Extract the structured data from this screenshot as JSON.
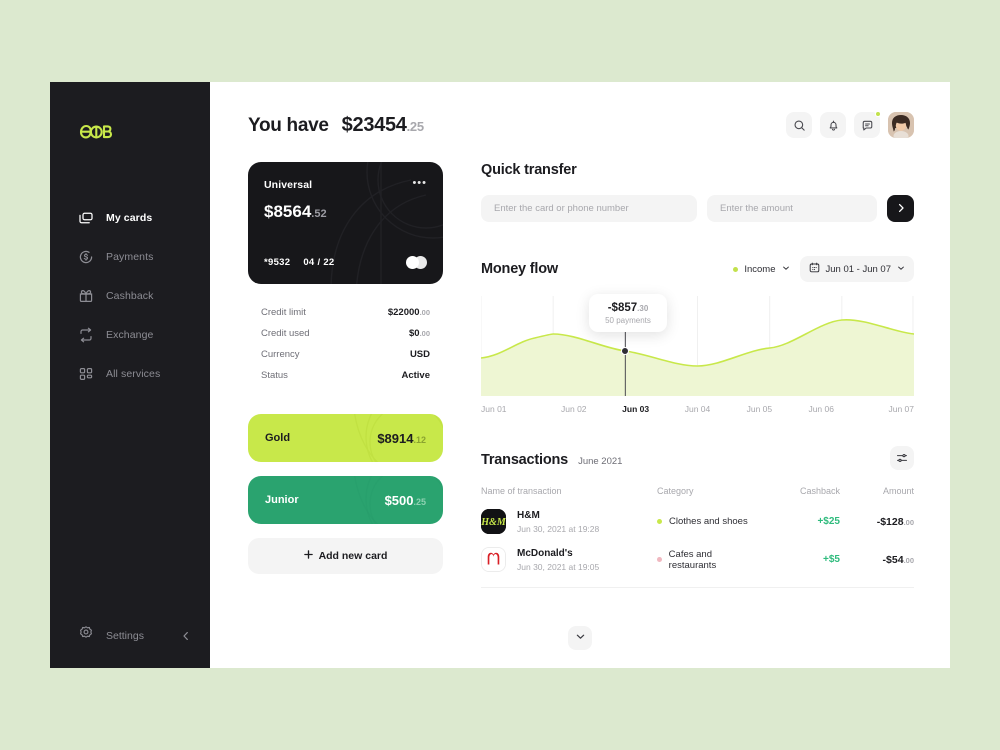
{
  "sidebar": {
    "logo_name": "brand-logo",
    "items": [
      {
        "label": "My cards",
        "icon": "cards-icon",
        "active": true
      },
      {
        "label": "Payments",
        "icon": "dollar-circle-icon",
        "active": false
      },
      {
        "label": "Cashback",
        "icon": "gift-icon",
        "active": false
      },
      {
        "label": "Exchange",
        "icon": "exchange-icon",
        "active": false
      },
      {
        "label": "All services",
        "icon": "grid-icon",
        "active": false
      }
    ],
    "settings_label": "Settings",
    "settings_icon": "gear-icon",
    "collapse_icon": "chevron-left-icon"
  },
  "header": {
    "greeting": "You have",
    "balance": "$23454",
    "balance_cents": ".25",
    "icons": [
      "search-icon",
      "bell-icon",
      "chat-icon"
    ],
    "chat_has_badge": true,
    "avatar": "user-avatar"
  },
  "main_card": {
    "name": "Universal",
    "menu_icon": "more-dots-icon",
    "balance": "$8564",
    "balance_cents": ".52",
    "number": "*9532",
    "expiry": "04 / 22",
    "brand": "mastercard-logo",
    "details": [
      {
        "label": "Credit limit",
        "value": "$22000",
        "cents": ".00"
      },
      {
        "label": "Credit used",
        "value": "$0",
        "cents": ".00"
      },
      {
        "label": "Currency",
        "value": "USD",
        "cents": ""
      },
      {
        "label": "Status",
        "value": "Active",
        "cents": ""
      }
    ]
  },
  "mini_cards": [
    {
      "name": "Gold",
      "balance": "$8914",
      "cents": ".12",
      "color": "#c8e84a"
    },
    {
      "name": "Junior",
      "balance": "$500",
      "cents": ".25",
      "color": "#2aa36f"
    }
  ],
  "add_card": {
    "label": "Add new card",
    "icon": "plus-icon"
  },
  "quick_transfer": {
    "title": "Quick transfer",
    "card_placeholder": "Enter the card or phone number",
    "card_value": "",
    "amount_placeholder": "Enter the amount",
    "amount_value": "",
    "submit_icon": "chevron-right-icon"
  },
  "money_flow": {
    "title": "Money flow",
    "filter_label": "Income",
    "filter_chevron": "chevron-down-icon",
    "date_range": "Jun 01 - Jun 07",
    "calendar_icon": "calendar-icon",
    "tooltip": {
      "amount": "-$857",
      "cents": ".30",
      "sub": "50 payments"
    }
  },
  "chart_data": {
    "type": "area",
    "title": "Money flow",
    "categories": [
      "Jun 01",
      "Jun 02",
      "Jun 03",
      "Jun 04",
      "Jun 05",
      "Jun 06",
      "Jun 07"
    ],
    "x": [
      0,
      1,
      2,
      3,
      4,
      5,
      6
    ],
    "values": [
      38,
      58,
      45,
      30,
      48,
      76,
      62
    ],
    "ylim": [
      0,
      100
    ],
    "xlabel": "",
    "ylabel": "",
    "grid": true,
    "legend": [
      "Income"
    ],
    "line_color": "#c8e84a",
    "fill_color": "#eef6d2",
    "active_index": 2,
    "active_label": "Jun 03",
    "annotations": [
      {
        "x": 2,
        "label": "-$857.30",
        "sub": "50 payments"
      }
    ]
  },
  "transactions": {
    "title": "Transactions",
    "period": "June 2021",
    "filter_icon": "settings-sliders-icon",
    "columns": [
      "Name of transaction",
      "Category",
      "Cashback",
      "Amount"
    ],
    "rows": [
      {
        "logo": "hm-logo",
        "name": "H&M",
        "date": "Jun 30, 2021 at 19:28",
        "category": "Clothes and shoes",
        "category_color": "#c8e84a",
        "cashback": "+$25",
        "amount": "-$128",
        "amount_cents": ".00"
      },
      {
        "logo": "mcdonalds-logo",
        "name": "McDonald's",
        "date": "Jun 30, 2021 at 19:05",
        "category": "Cafes and restaurants",
        "category_color": "#f0b8c0",
        "cashback": "+$5",
        "amount": "-$54",
        "amount_cents": ".00"
      }
    ],
    "more_icon": "chevron-down-icon"
  }
}
